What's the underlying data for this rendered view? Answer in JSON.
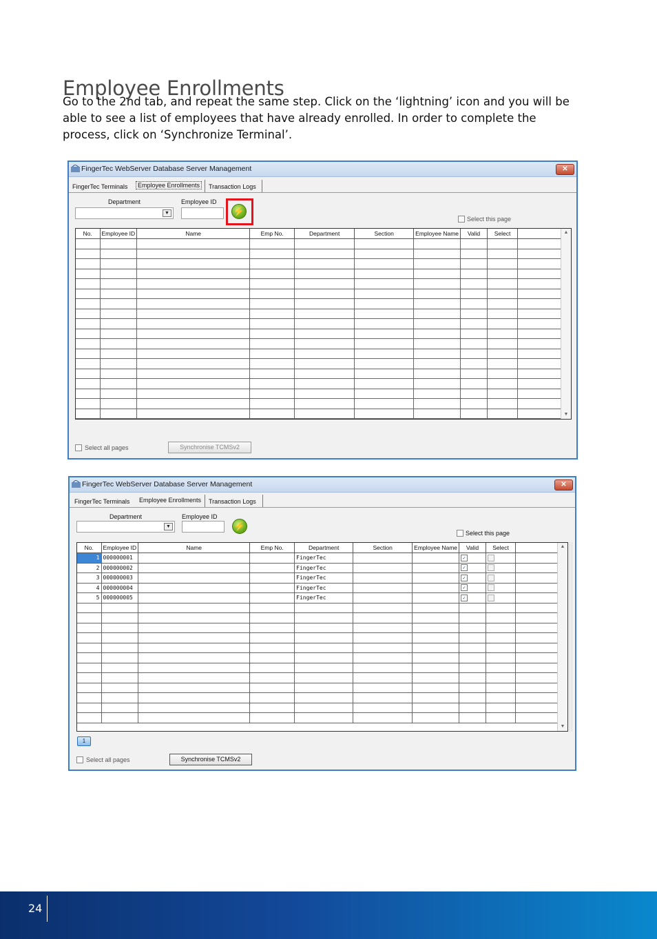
{
  "page": {
    "heading": "Employee Enrollments",
    "intro": "Go to the 2nd tab, and repeat the same step. Click on the ‘lightning’ icon and you will be able to see a list of employees that have already enrolled. In order to complete the process, click on ‘Synchronize Terminal’.",
    "page_number": "24"
  },
  "window": {
    "title": "FingerTec WebServer Database Server Management",
    "close": "✕",
    "tabs": [
      "FingerTec Terminals",
      "Employee Enrollments",
      "Transaction Logs"
    ],
    "department_label": "Department",
    "employee_id_label": "Employee ID",
    "select_page_label": "Select this page",
    "select_all_label": "Select all pages",
    "sync_label": "Synchronise TCMSv2",
    "columns": [
      "No.",
      "Employee ID",
      "Name",
      "Emp No.",
      "Department",
      "Section",
      "Employee Name",
      "Valid",
      "Select"
    ]
  },
  "screenshot2": {
    "pager": "1",
    "rows": [
      {
        "no": "1",
        "employee_id": "000000001",
        "department": "FingerTec"
      },
      {
        "no": "2",
        "employee_id": "000000002",
        "department": "FingerTec"
      },
      {
        "no": "3",
        "employee_id": "000000003",
        "department": "FingerTec"
      },
      {
        "no": "4",
        "employee_id": "000000004",
        "department": "FingerTec"
      },
      {
        "no": "5",
        "employee_id": "000000005",
        "department": "FingerTec"
      }
    ]
  },
  "icons": {
    "refresh": "lightning-refresh-icon",
    "dropdown": "chevron-down-icon",
    "app": "fingertec-app-icon"
  },
  "colors": {
    "highlight": "#e2141c",
    "selection": "#3d86d6",
    "footer_start": "#0b2f6c",
    "footer_end": "#0a88cd"
  }
}
